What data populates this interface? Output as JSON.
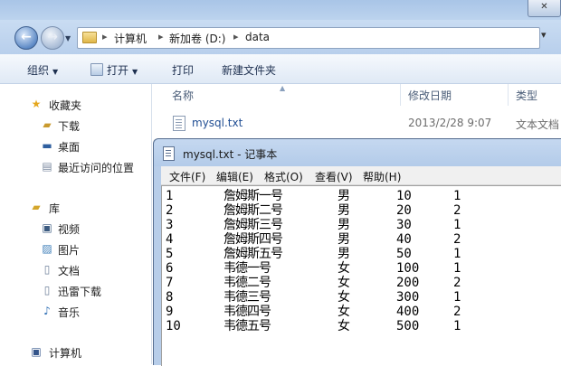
{
  "explorer": {
    "breadcrumbs": [
      "计算机",
      "新加卷 (D:)",
      "data"
    ],
    "toolbar": {
      "organize": "组织",
      "open": "打开",
      "print": "打印",
      "new_folder": "新建文件夹"
    },
    "nav": {
      "favorites": "收藏夹",
      "downloads": "下载",
      "desktop": "桌面",
      "recent": "最近访问的位置",
      "libraries": "库",
      "videos": "视频",
      "pictures": "图片",
      "documents": "文档",
      "thunder": "迅雷下载",
      "music": "音乐",
      "computer": "计算机"
    },
    "columns": {
      "name": "名称",
      "date": "修改日期",
      "type": "类型"
    },
    "files": [
      {
        "name": "mysql.txt",
        "date": "2013/2/28 9:07",
        "type": "文本文档"
      }
    ]
  },
  "notepad": {
    "title": "mysql.txt - 记事本",
    "menu": [
      "文件(F)",
      "编辑(E)",
      "格式(O)",
      "查看(V)",
      "帮助(H)"
    ],
    "rows": [
      [
        "1",
        "詹姆斯一号",
        "男",
        "10",
        "1"
      ],
      [
        "2",
        "詹姆斯二号",
        "男",
        "20",
        "2"
      ],
      [
        "3",
        "詹姆斯三号",
        "男",
        "30",
        "1"
      ],
      [
        "4",
        "詹姆斯四号",
        "男",
        "40",
        "2"
      ],
      [
        "5",
        "詹姆斯五号",
        "男",
        "50",
        "1"
      ],
      [
        "6",
        "韦德一号",
        "女",
        "100",
        "1"
      ],
      [
        "7",
        "韦德二号",
        "女",
        "200",
        "2"
      ],
      [
        "8",
        "韦德三号",
        "女",
        "300",
        "1"
      ],
      [
        "9",
        "韦德四号",
        "女",
        "400",
        "2"
      ],
      [
        "10",
        "韦德五号",
        "女",
        "500",
        "1"
      ]
    ]
  }
}
